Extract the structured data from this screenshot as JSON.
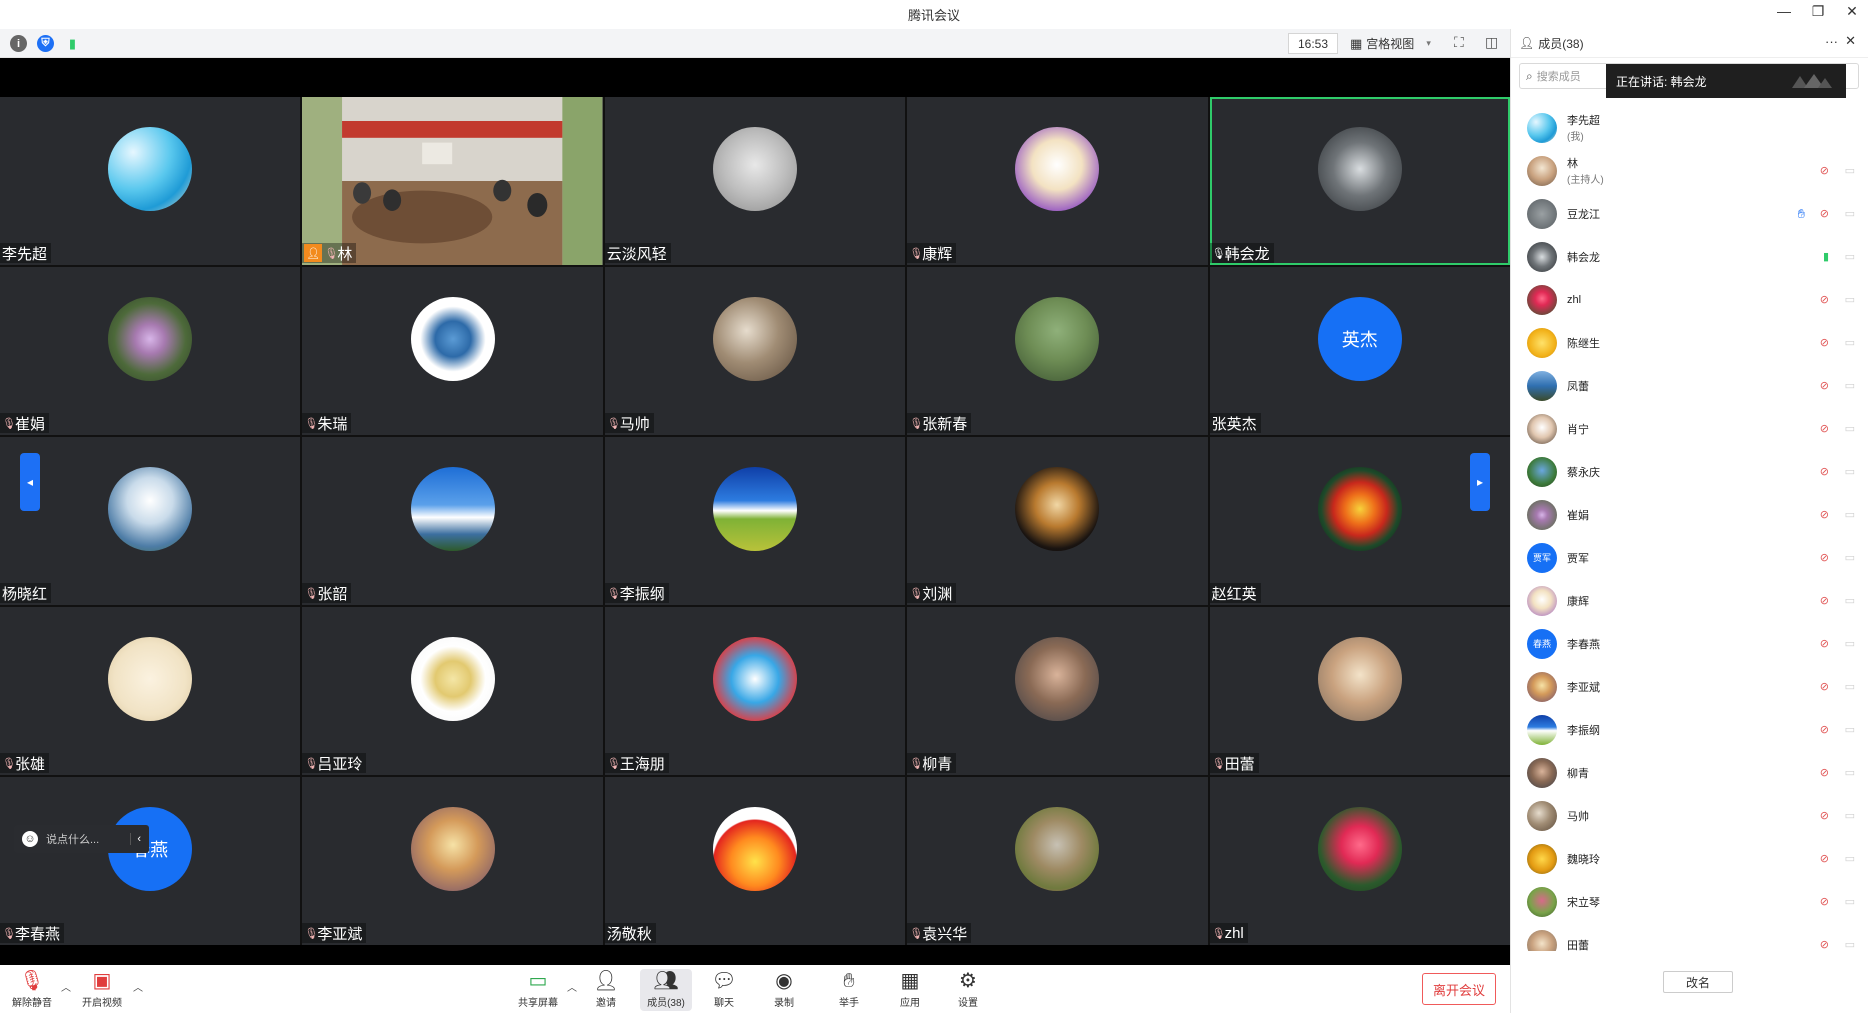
{
  "window": {
    "title": "腾讯会议"
  },
  "toolbar": {
    "time": "16:53",
    "view_label": "宫格视图"
  },
  "tiles": [
    {
      "name": "李先超",
      "mic": "none",
      "avatar": "ocean",
      "grad": "radial-gradient(circle at 30% 30%, #e6f7ff 0%, #5ac8ee 45%, #1f9bd6 70%, #f1e7cf 100%)"
    },
    {
      "name": "林",
      "mic": "muted",
      "host": true,
      "video": true
    },
    {
      "name": "云淡风轻",
      "mic": "none",
      "avatar": "sketch",
      "grad": "radial-gradient(circle at 50% 45%, #e8e8e8 0%, #bdbdbd 50%, #8a8a8a 100%)"
    },
    {
      "name": "康辉",
      "mic": "muted",
      "avatar": "cartoon",
      "grad": "radial-gradient(circle at 50% 45%, #ffffff 0%, #f3e2c2 40%, #9b5fc2 75%, #5a2c80 100%)"
    },
    {
      "name": "韩会龙",
      "mic": "on",
      "active": true,
      "avatar": "astronaut",
      "grad": "radial-gradient(circle at 50% 50%, #d9dde0 0%, #6f7478 45%, #2b2f33 100%)"
    },
    {
      "name": "崔娟",
      "mic": "muted",
      "avatar": "flower",
      "grad": "radial-gradient(circle at 50% 50%, #d7b5e8 0%, #a77ab0 25%, #4d6a3a 60%, #2e3f27 100%)"
    },
    {
      "name": "朱瑞",
      "mic": "muted",
      "avatar": "logo",
      "grad": "radial-gradient(circle at 50% 50%, #5b9bd5 0%, #2d6aa8 30%, #ffffff 55%, #ffffff 100%)"
    },
    {
      "name": "马帅",
      "mic": "muted",
      "avatar": "rock",
      "grad": "radial-gradient(circle at 40% 40%, #e6dccd 0%, #a08c74 45%, #5b4a3a 100%)"
    },
    {
      "name": "张新春",
      "mic": "muted",
      "avatar": "kids",
      "grad": "radial-gradient(circle at 50% 40%, #8fb07a 0%, #6e8d55 45%, #3a5230 100%)"
    },
    {
      "name": "张英杰",
      "mic": "none",
      "avatar": "text",
      "avatar_text": "英杰",
      "grad": "#1670f5"
    },
    {
      "name": "杨晓红",
      "mic": "none",
      "avatar": "clouds",
      "grad": "radial-gradient(circle at 50% 40%, #ffffff 0%, #c9dbea 35%, #4d7ca6 70%, #3b6a3a 100%)"
    },
    {
      "name": "张韶",
      "mic": "muted",
      "avatar": "sky",
      "grad": "linear-gradient(180deg, #1e6ed6 0%, #5aa0ea 45%, #ffffff 60%, #3c6fa0 80%, #2e5a2a 100%)"
    },
    {
      "name": "李振纲",
      "mic": "muted",
      "avatar": "field",
      "grad": "linear-gradient(180deg, #0f3fa8 0%, #2d7ce0 40%, #ffffff 52%, #7fb236 62%, #b9c23a 100%)"
    },
    {
      "name": "刘渊",
      "mic": "muted",
      "avatar": "carving",
      "grad": "radial-gradient(circle at 50% 45%, #f1d7a5 0%, #b97a2f 35%, #1a1411 70%, #000000 100%)"
    },
    {
      "name": "赵红英",
      "mic": "none",
      "avatar": "mandala",
      "grad": "radial-gradient(circle at 50% 50%, #f7d23b 0%, #ee6f1a 25%, #c8281c 45%, #1d4a2a 65%, #0d0d0d 100%)"
    },
    {
      "name": "张雄",
      "mic": "muted",
      "avatar": "doodle",
      "grad": "radial-gradient(circle at 50% 50%, #fbf2e0 0%, #f1e3c5 60%, #d9c59b 100%)"
    },
    {
      "name": "吕亚玲",
      "mic": "muted",
      "avatar": "tea",
      "grad": "radial-gradient(circle at 50% 50%, #f4e6a6 0%, #e2c970 30%, #ffffff 55%, #f4f4f4 100%)"
    },
    {
      "name": "王海朋",
      "mic": "muted",
      "avatar": "doraemon",
      "grad": "radial-gradient(circle at 50% 50%, #ffffff 0%, #38a7e6 40%, #e8373a 75%, #f5f5f5 100%)"
    },
    {
      "name": "柳青",
      "mic": "muted",
      "avatar": "family",
      "grad": "radial-gradient(circle at 50% 45%, #d9b39a 0%, #8a6a55 45%, #3a3d46 100%)"
    },
    {
      "name": "田蕾",
      "mic": "muted",
      "avatar": "girl",
      "grad": "radial-gradient(circle at 50% 45%, #f3e3c9 0%, #c9a27f 45%, #7a6a5c 100%)"
    },
    {
      "name": "李春燕",
      "mic": "muted",
      "avatar": "text",
      "avatar_text": "春燕",
      "grad": "#1670f5"
    },
    {
      "name": "李亚斌",
      "mic": "muted",
      "avatar": "anime",
      "grad": "radial-gradient(circle at 50% 45%, #f6e2a6 0%, #d49a5a 40%, #6a4a6e 100%)"
    },
    {
      "name": "汤敬秋",
      "mic": "none",
      "avatar": "fire",
      "grad": "radial-gradient(circle at 50% 65%, #ffe24a 0%, #ff8a1f 35%, #e3251f 60%, #ffffff 62%, #ffffff 100%)"
    },
    {
      "name": "袁兴华",
      "mic": "muted",
      "avatar": "meadow",
      "grad": "radial-gradient(circle at 50% 45%, #c7c1b4 0%, #9e8a63 40%, #6f7a3e 70%, #d14d78 100%)"
    },
    {
      "name": "zhl",
      "mic": "muted",
      "avatar": "rose",
      "grad": "radial-gradient(circle at 50% 45%, #ff6a8a 0%, #e12a55 30%, #2b5a2c 65%, #1b3a1d 100%)"
    }
  ],
  "chat": {
    "placeholder": "说点什么..."
  },
  "bottombar": {
    "unmute": "解除静音",
    "start_video": "开启视频",
    "share": "共享屏幕",
    "invite": "邀请",
    "members": "成员(38)",
    "chat": "聊天",
    "record": "录制",
    "raise_hand": "举手",
    "apps": "应用",
    "settings": "设置",
    "leave": "离开会议"
  },
  "panel": {
    "header": "成员(38)",
    "search_placeholder": "搜索成员",
    "speaking": "正在讲话: 韩会龙",
    "rename": "改名",
    "members": [
      {
        "name": "李先超",
        "sub": "(我)",
        "grad": "radial-gradient(circle at 30% 30%, #e6f7ff 0%, #5ac8ee 45%, #1f9bd6 70%, #f1e7cf 100%)",
        "mic": "none",
        "cam": false
      },
      {
        "name": "林",
        "sub": "(主持人)",
        "grad": "radial-gradient(circle at 50% 40%, #f3e6d2 0%, #c9a27f 50%, #6d5847 100%)",
        "mic": "muted",
        "cam": true
      },
      {
        "name": "豆龙江",
        "sub": "",
        "grad": "radial-gradient(circle at 50% 50%, #9aa0a3 0%, #565c60 100%)",
        "mic": "muted",
        "cam": true,
        "hand": true
      },
      {
        "name": "韩会龙",
        "sub": "",
        "grad": "radial-gradient(circle at 50% 50%, #d9dde0 0%, #6f7478 45%, #2b2f33 100%)",
        "mic": "on",
        "cam": true
      },
      {
        "name": "zhl",
        "sub": "",
        "grad": "radial-gradient(circle at 50% 45%, #ff6a8a 0%, #e12a55 30%, #2b5a2c 100%)",
        "mic": "muted",
        "cam": true
      },
      {
        "name": "陈继生",
        "sub": "",
        "grad": "radial-gradient(circle at 50% 50%, #ffe26a 0%, #f2b21a 60%, #c68612 100%)",
        "mic": "muted",
        "cam": true
      },
      {
        "name": "凤蕾",
        "sub": "",
        "grad": "linear-gradient(180deg, #7fb0e0 0%, #2f6fb0 50%, #3b4a2a 100%)",
        "mic": "muted",
        "cam": true
      },
      {
        "name": "肖宁",
        "sub": "",
        "grad": "radial-gradient(circle at 50% 45%, #ffffff 0%, #e1c7b0 45%, #4a3a2e 100%)",
        "mic": "muted",
        "cam": true
      },
      {
        "name": "蔡永庆",
        "sub": "",
        "grad": "radial-gradient(circle at 50% 45%, #6aa7e0 0%, #3c7a3a 60%, #2a3f22 100%)",
        "mic": "muted",
        "cam": true
      },
      {
        "name": "崔娟",
        "sub": "",
        "grad": "radial-gradient(circle at 50% 50%, #d7b5e8 0%, #a77ab0 25%, #4d6a3a 100%)",
        "mic": "muted",
        "cam": true
      },
      {
        "name": "贾军",
        "sub": "",
        "grad": "#1670f5",
        "text": "贾军",
        "mic": "muted",
        "cam": true
      },
      {
        "name": "康辉",
        "sub": "",
        "grad": "radial-gradient(circle at 50% 45%, #ffffff 0%, #f3e2c2 40%, #9b5fc2 100%)",
        "mic": "muted",
        "cam": true
      },
      {
        "name": "李春燕",
        "sub": "",
        "grad": "#1670f5",
        "text": "春燕",
        "mic": "muted",
        "cam": true
      },
      {
        "name": "李亚斌",
        "sub": "",
        "grad": "radial-gradient(circle at 50% 45%, #f6e2a6 0%, #d49a5a 40%, #6a4a6e 100%)",
        "mic": "muted",
        "cam": true
      },
      {
        "name": "李振纲",
        "sub": "",
        "grad": "linear-gradient(180deg, #0f3fa8 0%, #2d7ce0 40%, #ffffff 52%, #7fb236 100%)",
        "mic": "muted",
        "cam": true
      },
      {
        "name": "柳青",
        "sub": "",
        "grad": "radial-gradient(circle at 50% 45%, #d9b39a 0%, #8a6a55 45%, #3a3d46 100%)",
        "mic": "muted",
        "cam": true
      },
      {
        "name": "马帅",
        "sub": "",
        "grad": "radial-gradient(circle at 40% 40%, #e6dccd 0%, #a08c74 45%, #5b4a3a 100%)",
        "mic": "muted",
        "cam": true
      },
      {
        "name": "魏晓玲",
        "sub": "",
        "grad": "radial-gradient(circle at 50% 50%, #ffd84a 0%, #e39a12 55%, #6a5a1a 100%)",
        "mic": "muted",
        "cam": true
      },
      {
        "name": "宋立琴",
        "sub": "",
        "grad": "radial-gradient(circle at 50% 45%, #d86a8a 0%, #7aa34a 55%, #3a5a2a 100%)",
        "mic": "muted",
        "cam": true
      },
      {
        "name": "田蕾",
        "sub": "",
        "grad": "radial-gradient(circle at 50% 45%, #f3e3c9 0%, #c9a27f 45%, #7a6a5c 100%)",
        "mic": "muted",
        "cam": true
      }
    ]
  },
  "colors": {
    "accent": "#1670f5",
    "speaking_border": "#2fcb6a",
    "leave": "#e03d3d",
    "tile_bg": "#292b2f"
  }
}
